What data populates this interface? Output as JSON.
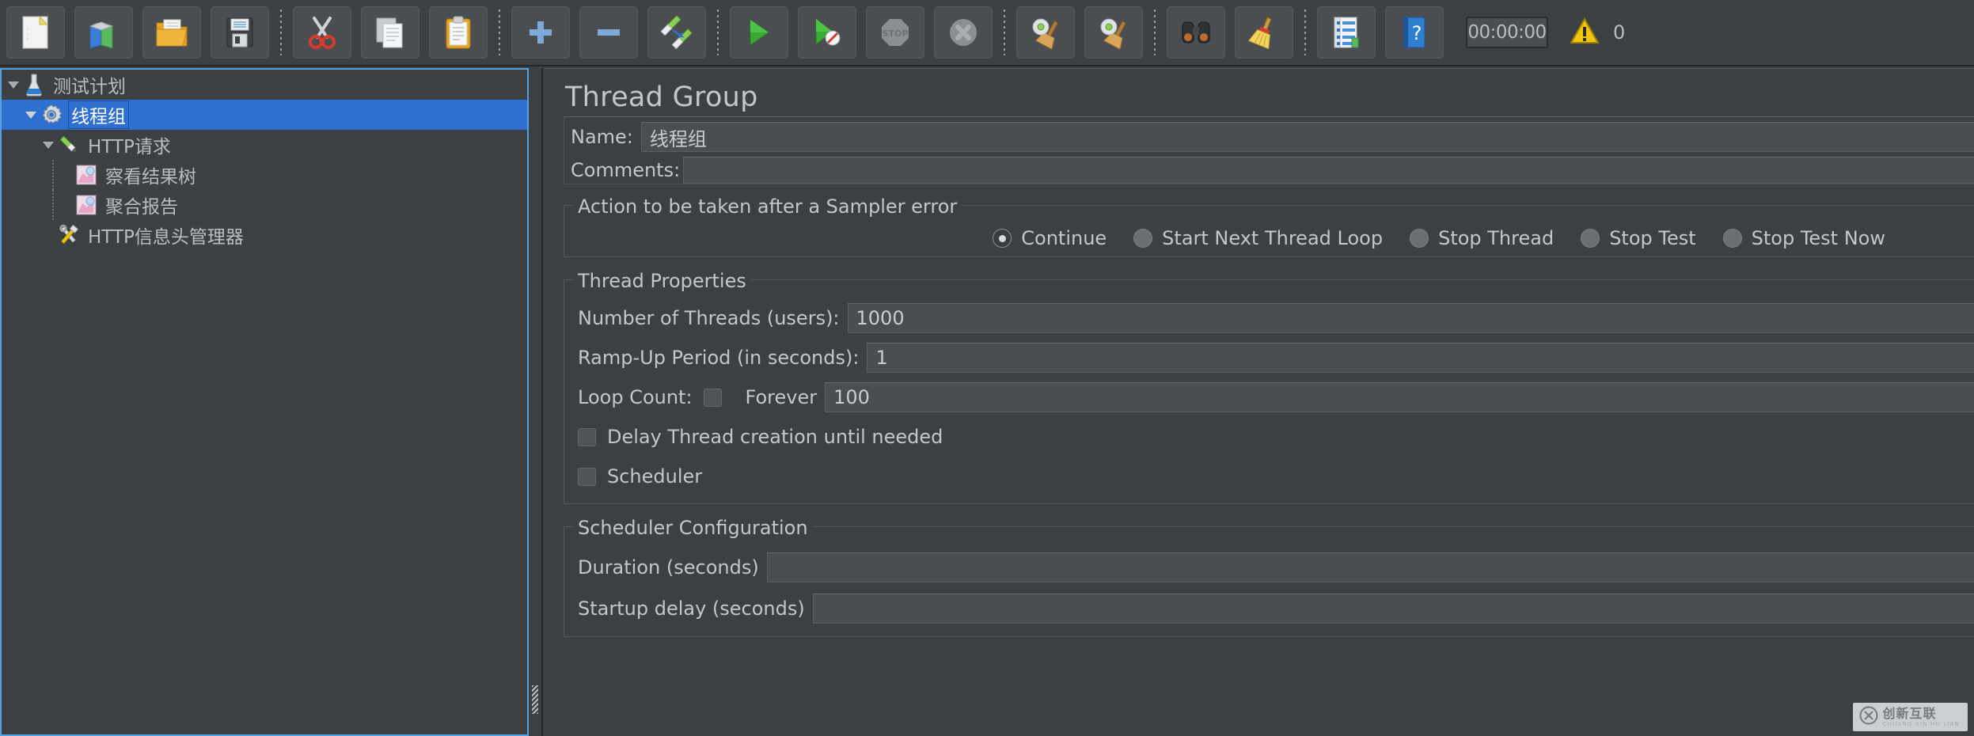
{
  "toolbar": {
    "buttons": [
      {
        "name": "new-button",
        "icon": "new-document-icon",
        "tooltip": "New"
      },
      {
        "name": "templates-button",
        "icon": "templates-books-icon",
        "tooltip": "Templates"
      },
      {
        "name": "open-button",
        "icon": "open-folder-icon",
        "tooltip": "Open"
      },
      {
        "name": "save-button",
        "icon": "save-floppy-icon",
        "tooltip": "Save Test Plan"
      },
      {
        "name": "cut-button",
        "icon": "scissors-icon",
        "tooltip": "Cut"
      },
      {
        "name": "copy-button",
        "icon": "copy-pages-icon",
        "tooltip": "Copy"
      },
      {
        "name": "paste-button",
        "icon": "clipboard-paste-icon",
        "tooltip": "Paste"
      },
      {
        "name": "expand-all-button",
        "icon": "plus-icon",
        "tooltip": "Expand All"
      },
      {
        "name": "collapse-all-button",
        "icon": "minus-icon",
        "tooltip": "Collapse All"
      },
      {
        "name": "toggle-button",
        "icon": "toggle-pencils-icon",
        "tooltip": "Toggle"
      },
      {
        "name": "start-button",
        "icon": "green-play-icon",
        "tooltip": "Start"
      },
      {
        "name": "start-no-pauses-button",
        "icon": "green-play-nopause-icon",
        "tooltip": "Start no pauses"
      },
      {
        "name": "stop-button",
        "icon": "stop-sign-icon",
        "tooltip": "Stop"
      },
      {
        "name": "shutdown-button",
        "icon": "shutdown-x-icon",
        "tooltip": "Shutdown"
      },
      {
        "name": "clear-button",
        "icon": "broom-gear-icon",
        "tooltip": "Clear"
      },
      {
        "name": "clear-all-button",
        "icon": "broom-gear-all-icon",
        "tooltip": "Clear All"
      },
      {
        "name": "search-button",
        "icon": "binoculars-icon",
        "tooltip": "Search"
      },
      {
        "name": "reset-search-button",
        "icon": "yellow-broom-icon",
        "tooltip": "Reset Search"
      },
      {
        "name": "function-helper-button",
        "icon": "function-list-icon",
        "tooltip": "Function Helper Dialog"
      },
      {
        "name": "help-button",
        "icon": "blue-help-book-icon",
        "tooltip": "Help"
      }
    ],
    "timer_value": "00:00:00",
    "warning_count": "0"
  },
  "tree": {
    "nodes": [
      {
        "label": "测试计划",
        "icon": "test-plan-flask-icon",
        "depth": 0,
        "expanded": true,
        "selected": false,
        "has_arrow": true
      },
      {
        "label": "线程组",
        "icon": "thread-group-gear-icon",
        "depth": 1,
        "expanded": true,
        "selected": true,
        "has_arrow": true
      },
      {
        "label": "HTTP请求",
        "icon": "http-sampler-pencil-icon",
        "depth": 2,
        "expanded": true,
        "selected": false,
        "has_arrow": true
      },
      {
        "label": "察看结果树",
        "icon": "view-results-tree-chart-icon",
        "depth": 3,
        "expanded": false,
        "selected": false,
        "has_arrow": false
      },
      {
        "label": "聚合报告",
        "icon": "aggregate-report-chart-icon",
        "depth": 3,
        "expanded": false,
        "selected": false,
        "has_arrow": false
      },
      {
        "label": "HTTP信息头管理器",
        "icon": "header-manager-tools-icon",
        "depth": 2,
        "expanded": false,
        "selected": false,
        "has_arrow": false
      }
    ]
  },
  "panel": {
    "title": "Thread Group",
    "name_label": "Name:",
    "name_value": "线程组",
    "comments_label": "Comments:",
    "comments_value": "",
    "error_action": {
      "legend": "Action to be taken after a Sampler error",
      "options": [
        {
          "label": "Continue",
          "selected": true
        },
        {
          "label": "Start Next Thread Loop",
          "selected": false
        },
        {
          "label": "Stop Thread",
          "selected": false
        },
        {
          "label": "Stop Test",
          "selected": false
        },
        {
          "label": "Stop Test Now",
          "selected": false
        }
      ]
    },
    "thread_properties": {
      "legend": "Thread Properties",
      "num_threads_label": "Number of Threads (users):",
      "num_threads_value": "1000",
      "ramp_up_label": "Ramp-Up Period (in seconds):",
      "ramp_up_value": "1",
      "loop_count_label": "Loop Count:",
      "forever_label": "Forever",
      "forever_checked": false,
      "loop_count_value": "100",
      "delay_thread_label": "Delay Thread creation until needed",
      "delay_thread_checked": false,
      "scheduler_label": "Scheduler",
      "scheduler_checked": false
    },
    "scheduler_config": {
      "legend": "Scheduler Configuration",
      "duration_label": "Duration (seconds)",
      "duration_value": "",
      "startup_delay_label": "Startup delay (seconds)",
      "startup_delay_value": ""
    }
  },
  "watermark": {
    "main": "创新互联",
    "sub": "CHUANG XIN HU LIAN"
  },
  "colors": {
    "accent": "#4fa3e3",
    "selection": "#2f6fd0",
    "panel_bg": "#3c4043",
    "field_bg": "#4a4e51",
    "text": "#c3c7ca"
  }
}
